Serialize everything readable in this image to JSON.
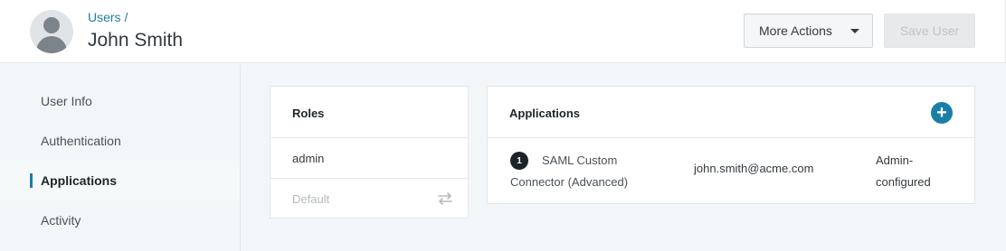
{
  "header": {
    "breadcrumb": "Users /",
    "title": "John Smith",
    "more_actions_label": "More Actions",
    "save_label": "Save User"
  },
  "sidebar": {
    "items": [
      {
        "label": "User Info",
        "active": false
      },
      {
        "label": "Authentication",
        "active": false
      },
      {
        "label": "Applications",
        "active": true
      },
      {
        "label": "Activity",
        "active": false
      }
    ]
  },
  "roles": {
    "title": "Roles",
    "items": [
      {
        "label": "admin"
      },
      {
        "label": "Default"
      }
    ]
  },
  "applications": {
    "title": "Applications",
    "rows": [
      {
        "badge": "1",
        "name": "SAML Custom Connector (Advanced)",
        "email": "john.smith@acme.com",
        "status": "Admin-configured"
      }
    ]
  },
  "colors": {
    "accent": "#1a7fa6",
    "background": "#f2f6f8"
  }
}
